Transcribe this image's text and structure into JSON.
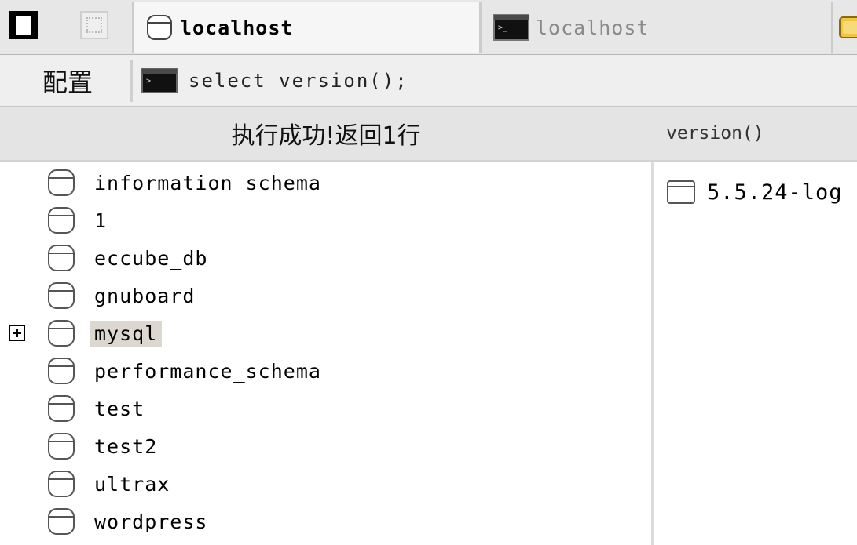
{
  "tabbar": {
    "tabs": [
      {
        "label": "localhost",
        "icon": "database-icon",
        "active": true
      },
      {
        "label": "localhost",
        "icon": "terminal-icon",
        "active": false
      },
      {
        "label": "",
        "icon": "folder-icon",
        "active": false
      }
    ]
  },
  "toolbar": {
    "config_label": "配置",
    "query_text": "select version();"
  },
  "result": {
    "status": "执行成功!返回1行",
    "columns": [
      "version()"
    ],
    "rows": [
      [
        "5.5.24-log"
      ]
    ]
  },
  "databases": [
    {
      "name": "information_schema"
    },
    {
      "name": "1"
    },
    {
      "name": "eccube_db"
    },
    {
      "name": "gnuboard"
    },
    {
      "name": "mysql",
      "selected": true,
      "expandable": true
    },
    {
      "name": "performance_schema"
    },
    {
      "name": "test"
    },
    {
      "name": "test2"
    },
    {
      "name": "ultrax"
    },
    {
      "name": "wordpress"
    }
  ],
  "colors": {
    "selection": "#dcd8d0",
    "header_bg": "#e4e4e4",
    "toolbar_bg": "#efefef"
  }
}
